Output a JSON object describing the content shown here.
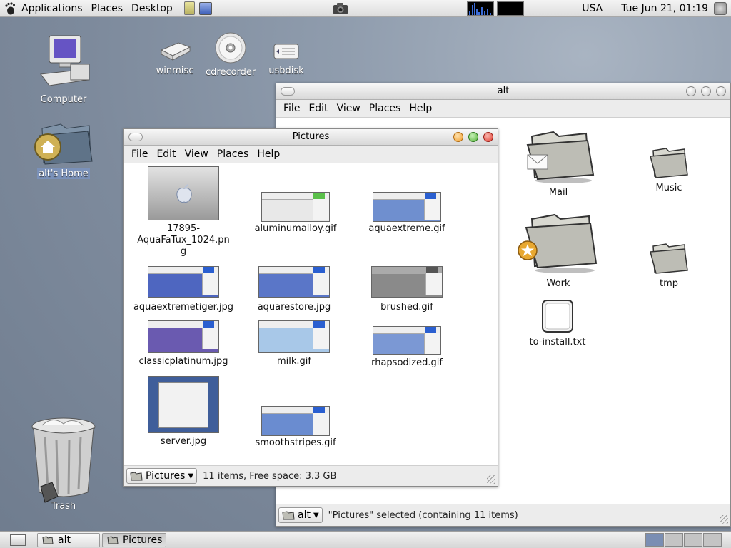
{
  "top_panel": {
    "menus": [
      "Applications",
      "Places",
      "Desktop"
    ],
    "keyboard_layout": "USA",
    "clock": "Tue Jun 21, 01:19"
  },
  "desktop": {
    "icons": [
      {
        "label": "Computer"
      },
      {
        "label": "alt's Home"
      },
      {
        "label": "winmisc"
      },
      {
        "label": "cdrecorder"
      },
      {
        "label": "usbdisk"
      },
      {
        "label": "Trash"
      }
    ]
  },
  "alt_window": {
    "title": "alt",
    "menus": [
      "File",
      "Edit",
      "View",
      "Places",
      "Help"
    ],
    "items": [
      {
        "label": "Mail"
      },
      {
        "label": "Music"
      },
      {
        "label": "Work"
      },
      {
        "label": "tmp"
      },
      {
        "label": "to-install.txt"
      }
    ],
    "location": "alt",
    "status": "\"Pictures\" selected (containing 11 items)"
  },
  "pictures_window": {
    "title": "Pictures",
    "menus": [
      "File",
      "Edit",
      "View",
      "Places",
      "Help"
    ],
    "files": [
      {
        "label_lines": [
          "17895-",
          "AquaFaTux_1024.pn",
          "g"
        ]
      },
      {
        "label": "aluminumalloy.gif"
      },
      {
        "label": "aquaextreme.gif"
      },
      {
        "label": "aquaextremetiger.jpg"
      },
      {
        "label": "aquarestore.jpg"
      },
      {
        "label": "brushed.gif"
      },
      {
        "label": "classicplatinum.jpg"
      },
      {
        "label": "milk.gif"
      },
      {
        "label": "rhapsodized.gif"
      },
      {
        "label": "server.jpg"
      },
      {
        "label": "smoothstripes.gif"
      }
    ],
    "location": "Pictures",
    "status": "11 items, Free space: 3.3 GB"
  },
  "taskbar": {
    "tasks": [
      {
        "label": "alt"
      },
      {
        "label": "Pictures"
      }
    ]
  }
}
